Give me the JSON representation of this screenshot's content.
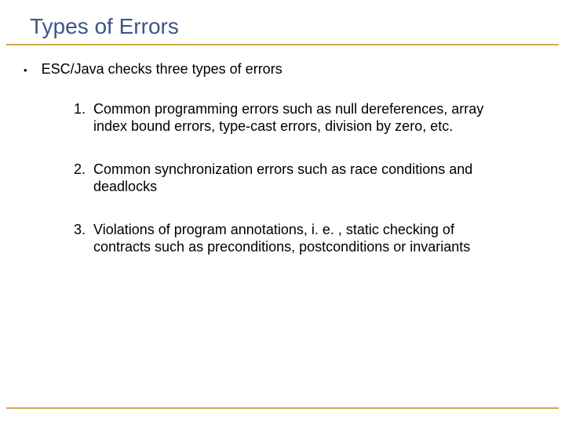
{
  "slide": {
    "title": "Types of Errors",
    "bullet": "ESC/Java checks three types of errors",
    "items": [
      {
        "num": "1.",
        "text": "Common programming errors such as null dereferences, array index bound errors, type-cast errors, division by zero, etc."
      },
      {
        "num": "2.",
        "text": "Common synchronization errors such as race conditions and deadlocks"
      },
      {
        "num": "3.",
        "text": "Violations of program annotations, i. e. , static checking of contracts such as preconditions, postconditions or invariants"
      }
    ]
  }
}
